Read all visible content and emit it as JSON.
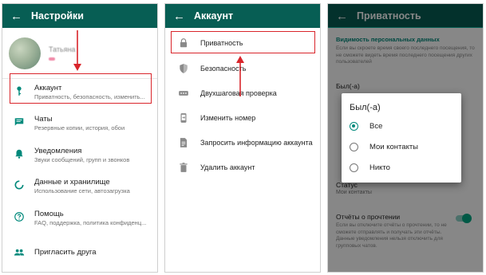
{
  "screen1": {
    "title": "Настройки",
    "profile_name": "Татьяна",
    "items": [
      {
        "title": "Аккаунт",
        "subtitle": "Приватность, безопасность, изменить...",
        "icon": "key-icon"
      },
      {
        "title": "Чаты",
        "subtitle": "Резервные копии, история, обои",
        "icon": "chat-icon"
      },
      {
        "title": "Уведомления",
        "subtitle": "Звуки сообщений, групп и звонков",
        "icon": "bell-icon"
      },
      {
        "title": "Данные и хранилище",
        "subtitle": "Использование сети, автозагрузка",
        "icon": "data-usage-icon"
      },
      {
        "title": "Помощь",
        "subtitle": "FAQ, поддержка, политика конфиденц...",
        "icon": "help-icon"
      },
      {
        "title": "Пригласить друга",
        "subtitle": "",
        "icon": "people-icon"
      }
    ]
  },
  "screen2": {
    "title": "Аккаунт",
    "items": [
      {
        "label": "Приватность",
        "icon": "lock-icon"
      },
      {
        "label": "Безопасность",
        "icon": "shield-icon"
      },
      {
        "label": "Двухшаговая проверка",
        "icon": "dots-icon"
      },
      {
        "label": "Изменить номер",
        "icon": "phone-change-icon"
      },
      {
        "label": "Запросить информацию аккаунта",
        "icon": "document-icon"
      },
      {
        "label": "Удалить аккаунт",
        "icon": "trash-icon"
      }
    ]
  },
  "screen3": {
    "title": "Приватность",
    "section": "Видимость персональных данных",
    "section_desc": "Если вы скроете время своего последнего посещения, то не сможете видеть время последнего посещения других пользователей",
    "last_seen_title": "Был(-а)",
    "status_title": "Статус",
    "status_value": "Мои контакты",
    "read_receipts_title": "Отчёты о прочтении",
    "read_receipts_desc": "Если вы отключите отчёты о прочтении, то не сможете отправлять и получать эти отчёты. Данные уведомления нельзя отключить для групповых чатов.",
    "read_receipts_on": true,
    "dialog": {
      "title": "Был(-а)",
      "options": [
        "Все",
        "Мои контакты",
        "Никто"
      ],
      "selected": 0
    }
  },
  "colors": {
    "appbar": "#075e54",
    "accent": "#00897b",
    "highlight": "#d9252b"
  }
}
